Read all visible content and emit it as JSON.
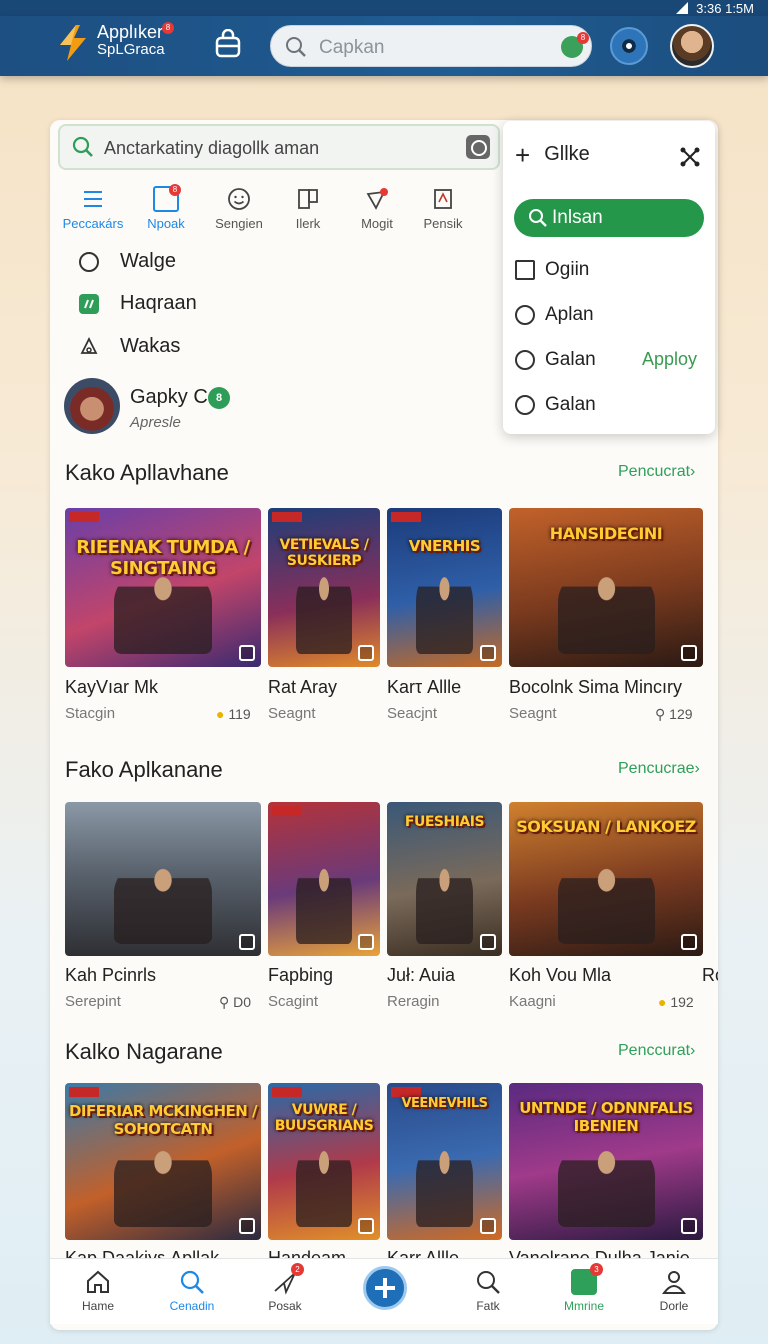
{
  "status": {
    "time": "3:36 1:5M"
  },
  "header": {
    "brand_line1": "Applıker",
    "brand_line2": "SpLGraca",
    "brand_badge": "8",
    "search_placeholder": "Capkan",
    "search_badge": "8"
  },
  "main_search": {
    "text": "Anctarkatiny diagollk aman"
  },
  "categories": [
    {
      "label": "Peccaκárs"
    },
    {
      "label": "Npoak",
      "badge": "8"
    },
    {
      "label": "Sengien"
    },
    {
      "label": "Ilerk"
    },
    {
      "label": "Mogit"
    },
    {
      "label": "Pensik"
    }
  ],
  "menu": [
    {
      "label": "Walge"
    },
    {
      "label": "Haqraan"
    },
    {
      "label": "Wakas"
    }
  ],
  "user": {
    "name": "Gapky C",
    "verified": "8",
    "subtitle": "Apresle"
  },
  "dropdown": {
    "title": "Gllke",
    "go_label": "Inlsan",
    "options": [
      "Ogiin",
      "Aplan",
      "Galan",
      "Galan"
    ],
    "apply_label": "Apploy"
  },
  "sections": [
    {
      "title": "Kako Apllavhane",
      "link": "Pencucrat›",
      "games": [
        {
          "art_text": "RIEENAK TUMDA / SINGTAING",
          "name": "KayVıar Mk",
          "sub": "Stacgin",
          "meta": "119",
          "meta_icon": "emoji-icon"
        },
        {
          "art_text": "VETIEVALS / SUSKIERP",
          "name": "Rat Aray",
          "sub": "Seagnt",
          "meta": ""
        },
        {
          "art_text": "VNERHIS",
          "name": "Karτ Allle",
          "sub": "Seacjnt",
          "meta": ""
        },
        {
          "art_text": "HANSIDECINI",
          "name": "Bocolnk Sima Mincıry",
          "sub": "Seagnt",
          "meta": "129",
          "meta_icon": "search-icon"
        }
      ]
    },
    {
      "title": "Fako Aplkanane",
      "link": "Pencucrae›",
      "games": [
        {
          "art_text": "",
          "name": "Kah Pcinrls",
          "sub": "Serepint",
          "meta": "D0",
          "meta_icon": "search-icon"
        },
        {
          "art_text": "",
          "name": "Fapbing",
          "sub": "Scagint",
          "meta": ""
        },
        {
          "art_text": "FUESHIAIS",
          "name": "Juł: Auia",
          "sub": "Reragin",
          "meta": ""
        },
        {
          "art_text": "SOKSUAN / LANKOEZ",
          "name": "Koh Vou Mla",
          "sub": "Kaagni",
          "meta": "192",
          "meta_icon": "emoji-icon",
          "extra": "Rc"
        }
      ]
    },
    {
      "title": "Kalko Nagarane",
      "link": "Penccurat›",
      "games": [
        {
          "art_text": "DIFERIAR MCKINGHEN / SOHOTCATN",
          "name": "Kap Daakiyε Apllak",
          "sub": "",
          "meta": ""
        },
        {
          "art_text": "VUWRE / BUUSGRIANS",
          "name": "Handeam",
          "sub": "",
          "meta": ""
        },
        {
          "art_text": "VEENEVHILS",
          "name": "Karr Allle",
          "sub": "",
          "meta": ""
        },
        {
          "art_text": "UNTNDE / ODNNFALIS IBENIEN",
          "name": "Vanelrane Dulha Janie",
          "sub": "",
          "meta": ""
        }
      ]
    }
  ],
  "bottom_nav": [
    {
      "label": "Hame"
    },
    {
      "label": "Cenadin"
    },
    {
      "label": "Posak",
      "badge": "2"
    },
    {
      "label": "Fatk"
    },
    {
      "label": "Mmrine",
      "badge": "3"
    },
    {
      "label": "Dorle"
    }
  ],
  "colors": {
    "appbar": "#1d4f82",
    "accent_green": "#25974a",
    "accent_blue": "#1e88e5",
    "badge_red": "#e53935"
  }
}
